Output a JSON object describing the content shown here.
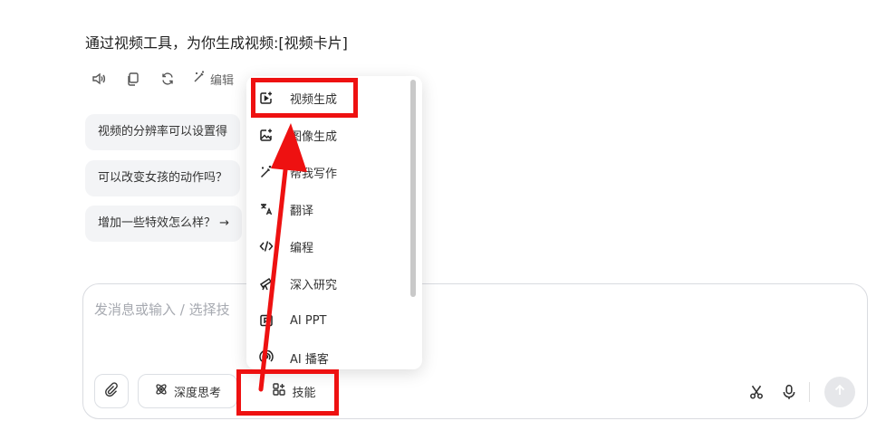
{
  "message": {
    "title": "通过视频工具，为你生成视频:[视频卡片]"
  },
  "actions": {
    "items": [
      {
        "icon": "speaker-icon"
      },
      {
        "icon": "copy-icon"
      },
      {
        "icon": "refresh-icon"
      }
    ],
    "edit_label": "编辑"
  },
  "suggestions": [
    {
      "text": "视频的分辨率可以设置得"
    },
    {
      "text": "可以改变女孩的动作吗？"
    },
    {
      "text": "增加一些特效怎么样？ →"
    }
  ],
  "skills_menu": {
    "items": [
      {
        "label": "视频生成",
        "icon": "video-generate-icon"
      },
      {
        "label": "图像生成",
        "icon": "image-generate-icon"
      },
      {
        "label": "帮我写作",
        "icon": "writing-wand-icon"
      },
      {
        "label": "翻译",
        "icon": "translate-icon"
      },
      {
        "label": "编程",
        "icon": "code-icon"
      },
      {
        "label": "深入研究",
        "icon": "telescope-icon"
      },
      {
        "label": "AI PPT",
        "icon": "ppt-icon"
      },
      {
        "label": "AI 播客",
        "icon": "podcast-icon"
      }
    ]
  },
  "composer": {
    "placeholder": "发消息或输入 / 选择技",
    "attach_icon": "paperclip-icon",
    "deep_think_label": "深度思考",
    "skills_label": "技能",
    "scissors_icon": "scissors-icon",
    "mic_icon": "microphone-icon",
    "send_icon": "arrow-up-icon"
  },
  "colors": {
    "highlight": "#ee1111",
    "composer_border": "#d9dbe0",
    "suggestion_bg": "#f3f4f6"
  }
}
